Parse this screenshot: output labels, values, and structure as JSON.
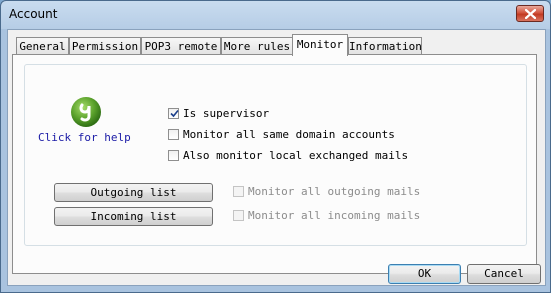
{
  "window": {
    "title": "Account"
  },
  "tabs": [
    {
      "label": "General",
      "active": false
    },
    {
      "label": "Permission",
      "active": false
    },
    {
      "label": "POP3 remote",
      "active": false
    },
    {
      "label": "More rules",
      "active": false
    },
    {
      "label": "Monitor",
      "active": true
    },
    {
      "label": "Information",
      "active": false
    }
  ],
  "monitor": {
    "help": {
      "icon": "help-logo-icon",
      "link_label": "Click for help"
    },
    "checkboxes": {
      "is_supervisor": {
        "label": "Is supervisor",
        "checked": true,
        "enabled": true
      },
      "monitor_same_domain": {
        "label": "Monitor all same domain accounts",
        "checked": false,
        "enabled": true
      },
      "monitor_local_exchanged": {
        "label": "Also monitor local exchanged mails",
        "checked": false,
        "enabled": true
      },
      "monitor_outgoing": {
        "label": "Monitor all outgoing mails",
        "checked": false,
        "enabled": false
      },
      "monitor_incoming": {
        "label": "Monitor all incoming mails",
        "checked": false,
        "enabled": false
      }
    },
    "buttons": {
      "outgoing_list": "Outgoing list",
      "incoming_list": "Incoming list"
    }
  },
  "footer": {
    "ok_label": "OK",
    "cancel_label": "Cancel"
  },
  "colors": {
    "link": "#1a1aa6",
    "logo_green": "#5aa12b",
    "close_red": "#c23a22"
  }
}
